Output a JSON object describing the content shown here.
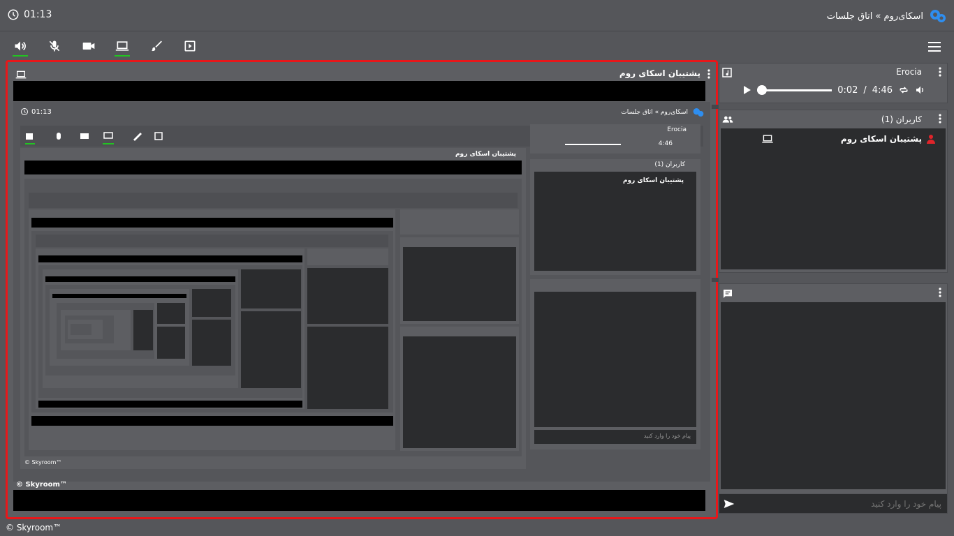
{
  "header": {
    "clock_time": "01:13",
    "breadcrumb": "اسکای‌روم » اتاق جلسات"
  },
  "toolbar": {
    "buttons": [
      {
        "name": "speaker",
        "active": true
      },
      {
        "name": "mic-muted",
        "active": false
      },
      {
        "name": "camera",
        "active": false
      },
      {
        "name": "screen-share",
        "active": true
      },
      {
        "name": "whiteboard",
        "active": false
      },
      {
        "name": "media-play",
        "active": false
      }
    ]
  },
  "main": {
    "title": "پشتیبان اسکای روم"
  },
  "music": {
    "title": "Erocia",
    "current_time": "0:02",
    "time_sep": "/",
    "duration": "4:46",
    "progress": 0.007
  },
  "users": {
    "title": "کاربران (1)",
    "list": [
      {
        "name": "پشتیبان اسکای روم"
      }
    ]
  },
  "chat": {
    "placeholder": "پیام خود را وارد کنید"
  },
  "footer": {
    "copyright": "© Skyroom™"
  },
  "colors": {
    "accent_green": "#22c322",
    "highlight_red": "#e8171a",
    "user_red": "#e0242a",
    "brand_blue": "#2e8ef0"
  }
}
